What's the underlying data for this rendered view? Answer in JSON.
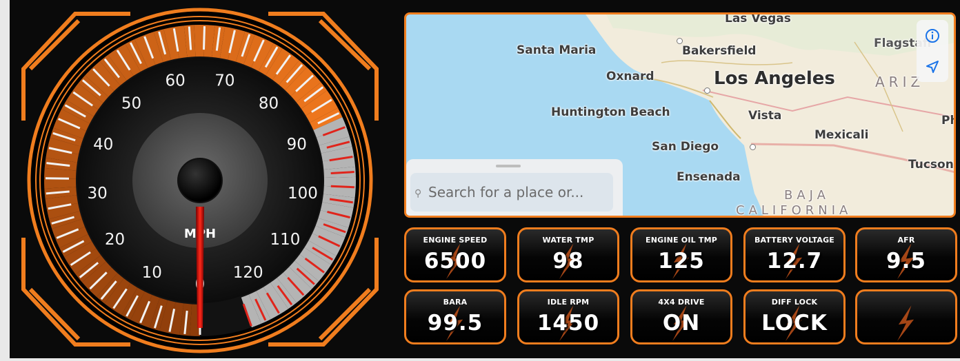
{
  "gauge": {
    "unit": "MPH",
    "ticks": [
      "0",
      "10",
      "20",
      "30",
      "40",
      "50",
      "60",
      "70",
      "80",
      "90",
      "100",
      "110",
      "120"
    ],
    "needle_value": 0,
    "accent_color": "#f07d1e",
    "redline_color": "#e0241b"
  },
  "map": {
    "cities": {
      "las_vegas": "Las Vegas",
      "santa_maria": "Santa Maria",
      "bakersfield": "Bakersfield",
      "flagstaff": "Flagstaff",
      "oxnard": "Oxnard",
      "los_angeles": "Los Angeles",
      "arizona": "ARIZ",
      "huntington_beach": "Huntington Beach",
      "vista": "Vista",
      "phoenix": "Ph",
      "mexicali": "Mexicali",
      "san_diego": "San Diego",
      "tucson": "Tucson",
      "ensenada": "Ensenada",
      "baja": "BAJA",
      "california": "CALIFORNIA"
    },
    "info_icon": "info-icon",
    "location_icon": "location-arrow-icon",
    "search_placeholder": "Search for a place or..."
  },
  "tiles": [
    {
      "label": "ENGINE SPEED",
      "value": "6500"
    },
    {
      "label": "WATER TMP",
      "value": "98"
    },
    {
      "label": "ENGINE OIL TMP",
      "value": "125"
    },
    {
      "label": "BATTERY VOLTAGE",
      "value": "12.7"
    },
    {
      "label": "AFR",
      "value": "9.5"
    },
    {
      "label": "BARA",
      "value": "99.5"
    },
    {
      "label": "IDLE RPM",
      "value": "1450"
    },
    {
      "label": "4X4 DRIVE",
      "value": "ON"
    },
    {
      "label": "DIFF LOCK",
      "value": "LOCK"
    },
    {
      "label": "",
      "value": ""
    }
  ]
}
